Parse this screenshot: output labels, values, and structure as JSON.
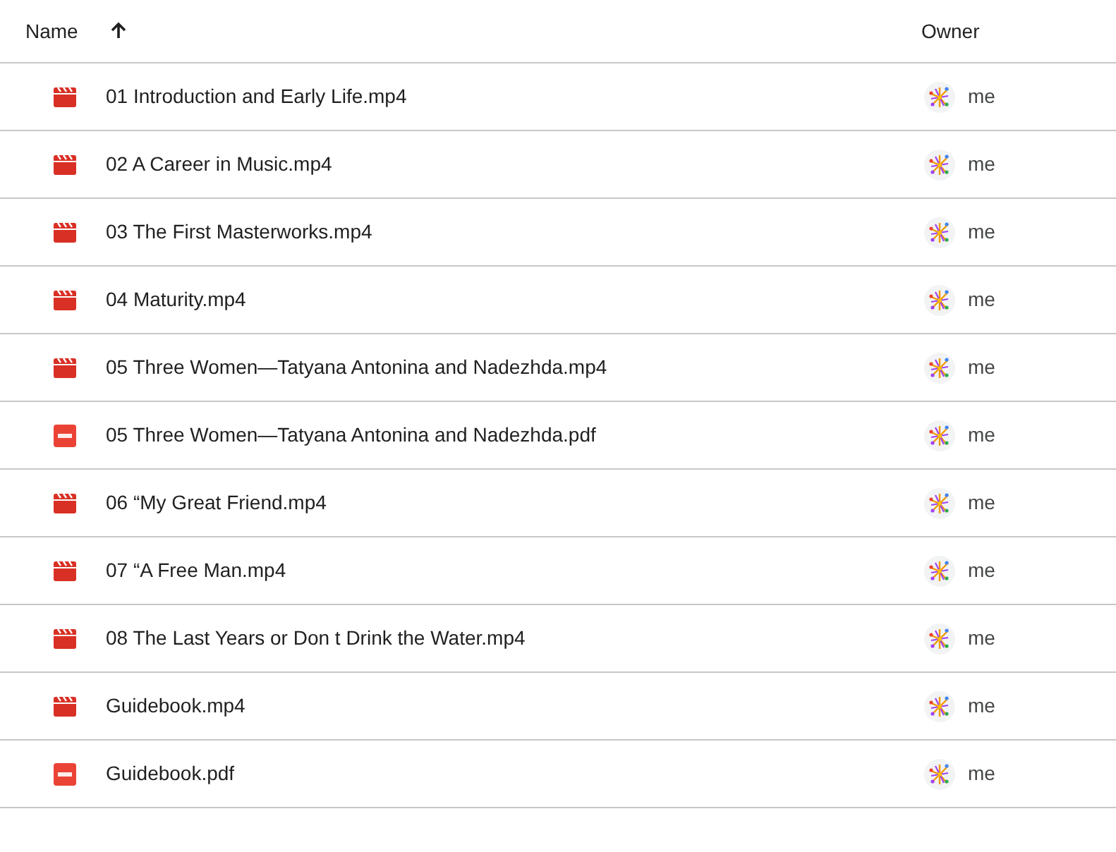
{
  "columns": [
    {
      "label": "Name",
      "sorted": true
    },
    {
      "label": "Owner"
    }
  ],
  "rows": [
    {
      "kind": "video",
      "name": "01 Introduction and Early Life.mp4",
      "owner": "me"
    },
    {
      "kind": "video",
      "name": "02 A Career in Music.mp4",
      "owner": "me"
    },
    {
      "kind": "video",
      "name": "03 The First Masterworks.mp4",
      "owner": "me"
    },
    {
      "kind": "video",
      "name": "04 Maturity.mp4",
      "owner": "me"
    },
    {
      "kind": "video",
      "name": "05 Three Women—Tatyana Antonina and Nadezhda.mp4",
      "owner": "me"
    },
    {
      "kind": "pdf",
      "name": "05 Three Women—Tatyana Antonina and Nadezhda.pdf",
      "owner": "me"
    },
    {
      "kind": "video",
      "name": "06 “My Great Friend.mp4",
      "owner": "me"
    },
    {
      "kind": "video",
      "name": "07 “A Free Man.mp4",
      "owner": "me"
    },
    {
      "kind": "video",
      "name": "08 The Last Years or Don t Drink the Water.mp4",
      "owner": "me"
    },
    {
      "kind": "video",
      "name": "Guidebook.mp4",
      "owner": "me"
    },
    {
      "kind": "pdf",
      "name": "Guidebook.pdf",
      "owner": "me"
    }
  ]
}
